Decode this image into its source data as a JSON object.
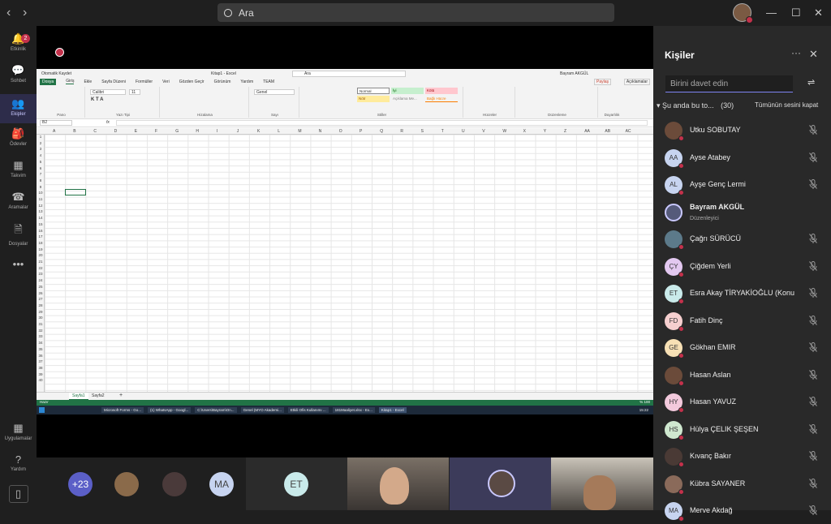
{
  "header": {
    "back": "‹",
    "forward": "›",
    "search_placeholder": "Ara",
    "min": "—",
    "max": "☐",
    "close": "✕"
  },
  "rail": [
    {
      "label": "Etkinlik",
      "glyph": "🔔",
      "badge": "2"
    },
    {
      "label": "Sohbet",
      "glyph": "💬"
    },
    {
      "label": "Ekipler",
      "glyph": "👥"
    },
    {
      "label": "Ödevler",
      "glyph": "🎒"
    },
    {
      "label": "Takvim",
      "glyph": "▦"
    },
    {
      "label": "Aramalar",
      "glyph": "☎"
    },
    {
      "label": "Dosyalar",
      "glyph": "🗎"
    },
    {
      "label": "",
      "glyph": "•••"
    },
    {
      "label": "Uygulamalar",
      "glyph": "▦"
    },
    {
      "label": "Yardım",
      "glyph": "?"
    },
    {
      "label": "",
      "glyph": "▯"
    }
  ],
  "excel": {
    "title": "Kitap1 - Excel",
    "autosave": "Otomatik Kaydet",
    "search": "Ara",
    "user": "Bayram AKGÜL",
    "tabs": [
      "Dosya",
      "Giriş",
      "Ekle",
      "Sayfa Düzeni",
      "Formüller",
      "Veri",
      "Gözden Geçir",
      "Görünüm",
      "Yardım",
      "TEAM"
    ],
    "share": "Paylaş",
    "comments": "Açıklamalar",
    "groups": [
      "Pano",
      "Yazı Tipi",
      "Hizalama",
      "Sayı",
      "Stiller",
      "Hücreler",
      "Düzenleme",
      "Duyarlılık"
    ],
    "font": "Calibri",
    "font_size": "11",
    "number_format": "Genel",
    "styles": [
      "Normal",
      "İyi",
      "Kötü",
      "Nötr",
      "Açıklama Me...",
      "Bağlı Hücre"
    ],
    "namebox": "B2",
    "fx": "fx",
    "columns": [
      "A",
      "B",
      "C",
      "D",
      "E",
      "F",
      "G",
      "H",
      "I",
      "J",
      "K",
      "L",
      "M",
      "N",
      "O",
      "P",
      "Q",
      "R",
      "S",
      "T",
      "U",
      "V",
      "W",
      "X",
      "Y",
      "Z",
      "AA",
      "AB",
      "AC"
    ],
    "sheets": [
      "Sayfa1",
      "Sayfa2"
    ],
    "add_sheet": "+",
    "status": "Hazır",
    "zoom": "% 100"
  },
  "taskbar": {
    "items": [
      "Microsoft Forms - Go...",
      "(1) WhatsApp - Googl...",
      "C:\\Users\\Bayram\\On...",
      "Genel (MYO Akademi...",
      "Etkili Ofis Kullanımı ...",
      "181Maaliyet.xlsx - Ex...",
      "Kitap1 - Excel"
    ],
    "clock": "15:22"
  },
  "bottom": {
    "more": "+23",
    "ma": "MA",
    "et": "ET"
  },
  "panel": {
    "title": "Kişiler",
    "more": "···",
    "close": "✕",
    "invite_placeholder": "Birini davet edin",
    "section": "Şu anda bu to...",
    "count": "(30)",
    "mute_all": "Tümünün sesini kapat",
    "people": [
      {
        "name": "Utku SOBUTAY",
        "initials": "",
        "color": "#6b4b3a",
        "bold": false
      },
      {
        "name": "Ayse Atabey",
        "initials": "AA",
        "color": "#c7d4f0",
        "bold": false
      },
      {
        "name": "Ayşe Genç Lermi",
        "initials": "AL",
        "color": "#c7d4f0",
        "bold": false
      },
      {
        "name": "Bayram AKGÜL",
        "initials": "",
        "color": "#555a7a",
        "bold": true,
        "role": "Düzenleyici"
      },
      {
        "name": "Çağrı SÜRÜCÜ",
        "initials": "",
        "color": "#5c7a8a",
        "bold": false
      },
      {
        "name": "Çiğdem Yerli",
        "initials": "ÇY",
        "color": "#e3c8f0",
        "bold": false
      },
      {
        "name": "Esra Akay TİRYAKİOĞLU (Konu",
        "initials": "ET",
        "color": "#c9eaea",
        "bold": false
      },
      {
        "name": "Fatih Dinç",
        "initials": "FD",
        "color": "#f6cfcf",
        "bold": false
      },
      {
        "name": "Gökhan EMIR",
        "initials": "GE",
        "color": "#f7e0b5",
        "bold": false
      },
      {
        "name": "Hasan Aslan",
        "initials": "",
        "color": "#6b4b3a",
        "bold": false
      },
      {
        "name": "Hasan YAVUZ",
        "initials": "HY",
        "color": "#f3c9dc",
        "bold": false
      },
      {
        "name": "Hülya ÇELIK ŞEŞEN",
        "initials": "HS",
        "color": "#cfe8cf",
        "bold": false
      },
      {
        "name": "Kıvanç Bakır",
        "initials": "",
        "color": "#4a3a35",
        "bold": false
      },
      {
        "name": "Kübra SAYANER",
        "initials": "",
        "color": "#8a6a5a",
        "bold": false
      },
      {
        "name": "Merve Akdağ",
        "initials": "MA",
        "color": "#c7d4f0",
        "bold": false
      }
    ]
  },
  "colors": {
    "accent": "#7f85f5",
    "excel_green": "#217346",
    "muted_red": "#c4314b"
  }
}
